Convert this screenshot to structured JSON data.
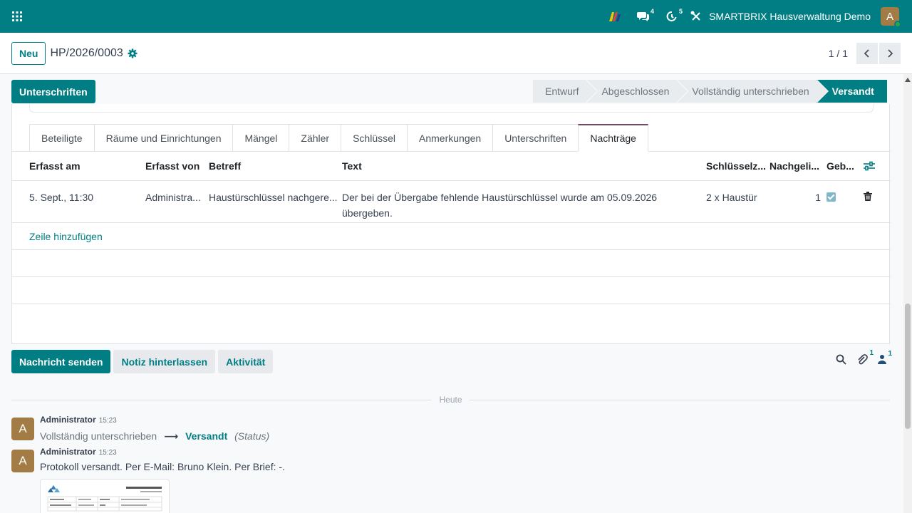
{
  "navbar": {
    "company": "SMARTBRIX Hausverwaltung Demo",
    "user_initial": "A",
    "messages_count": "4",
    "activities_count": "5",
    "accent": "#017e84"
  },
  "control_panel": {
    "new_label": "Neu",
    "record_name": "HP/2026/0003",
    "pager_value": "1 / 1"
  },
  "header": {
    "action_label": "Unterschriften",
    "stages": [
      "Entwurf",
      "Abgeschlossen",
      "Vollständig unterschrieben",
      "Versandt"
    ],
    "active_stage": "Versandt"
  },
  "tabs": [
    "Beteiligte",
    "Räume und Einrichtungen",
    "Mängel",
    "Zähler",
    "Schlüssel",
    "Anmerkungen",
    "Unterschriften",
    "Nachträge"
  ],
  "active_tab": "Nachträge",
  "table": {
    "columns": [
      "Erfasst am",
      "Erfasst von",
      "Betreff",
      "Text",
      "Schlüsselz...",
      "Nachgeli...",
      "Geb..."
    ],
    "rows": [
      {
        "date": "5. Sept., 11:30",
        "by": "Administra...",
        "subject": "Haustürschlüssel nachgere...",
        "text": "Der bei der Übergabe fehlende Haustürschlüssel wurde am 05.09.2026 übergeben.",
        "keys": "2 x Haustür",
        "delivered": "1",
        "checked": true
      }
    ],
    "add_line": "Zeile hinzufügen"
  },
  "chatter": {
    "send_label": "Nachricht senden",
    "note_label": "Notiz hinterlassen",
    "activity_label": "Aktivität",
    "attachments_count": "1",
    "followers_count": "1",
    "today_label": "Heute",
    "messages": [
      {
        "author": "Administrator",
        "time": "15:23",
        "initial": "A",
        "old_value": "Vollständig unterschrieben",
        "new_value": "Versandt",
        "field": "(Status)"
      },
      {
        "author": "Administrator",
        "time": "15:23",
        "initial": "A",
        "body": "Protokoll versandt. Per E-Mail: Bruno Klein. Per Brief: -."
      }
    ]
  }
}
